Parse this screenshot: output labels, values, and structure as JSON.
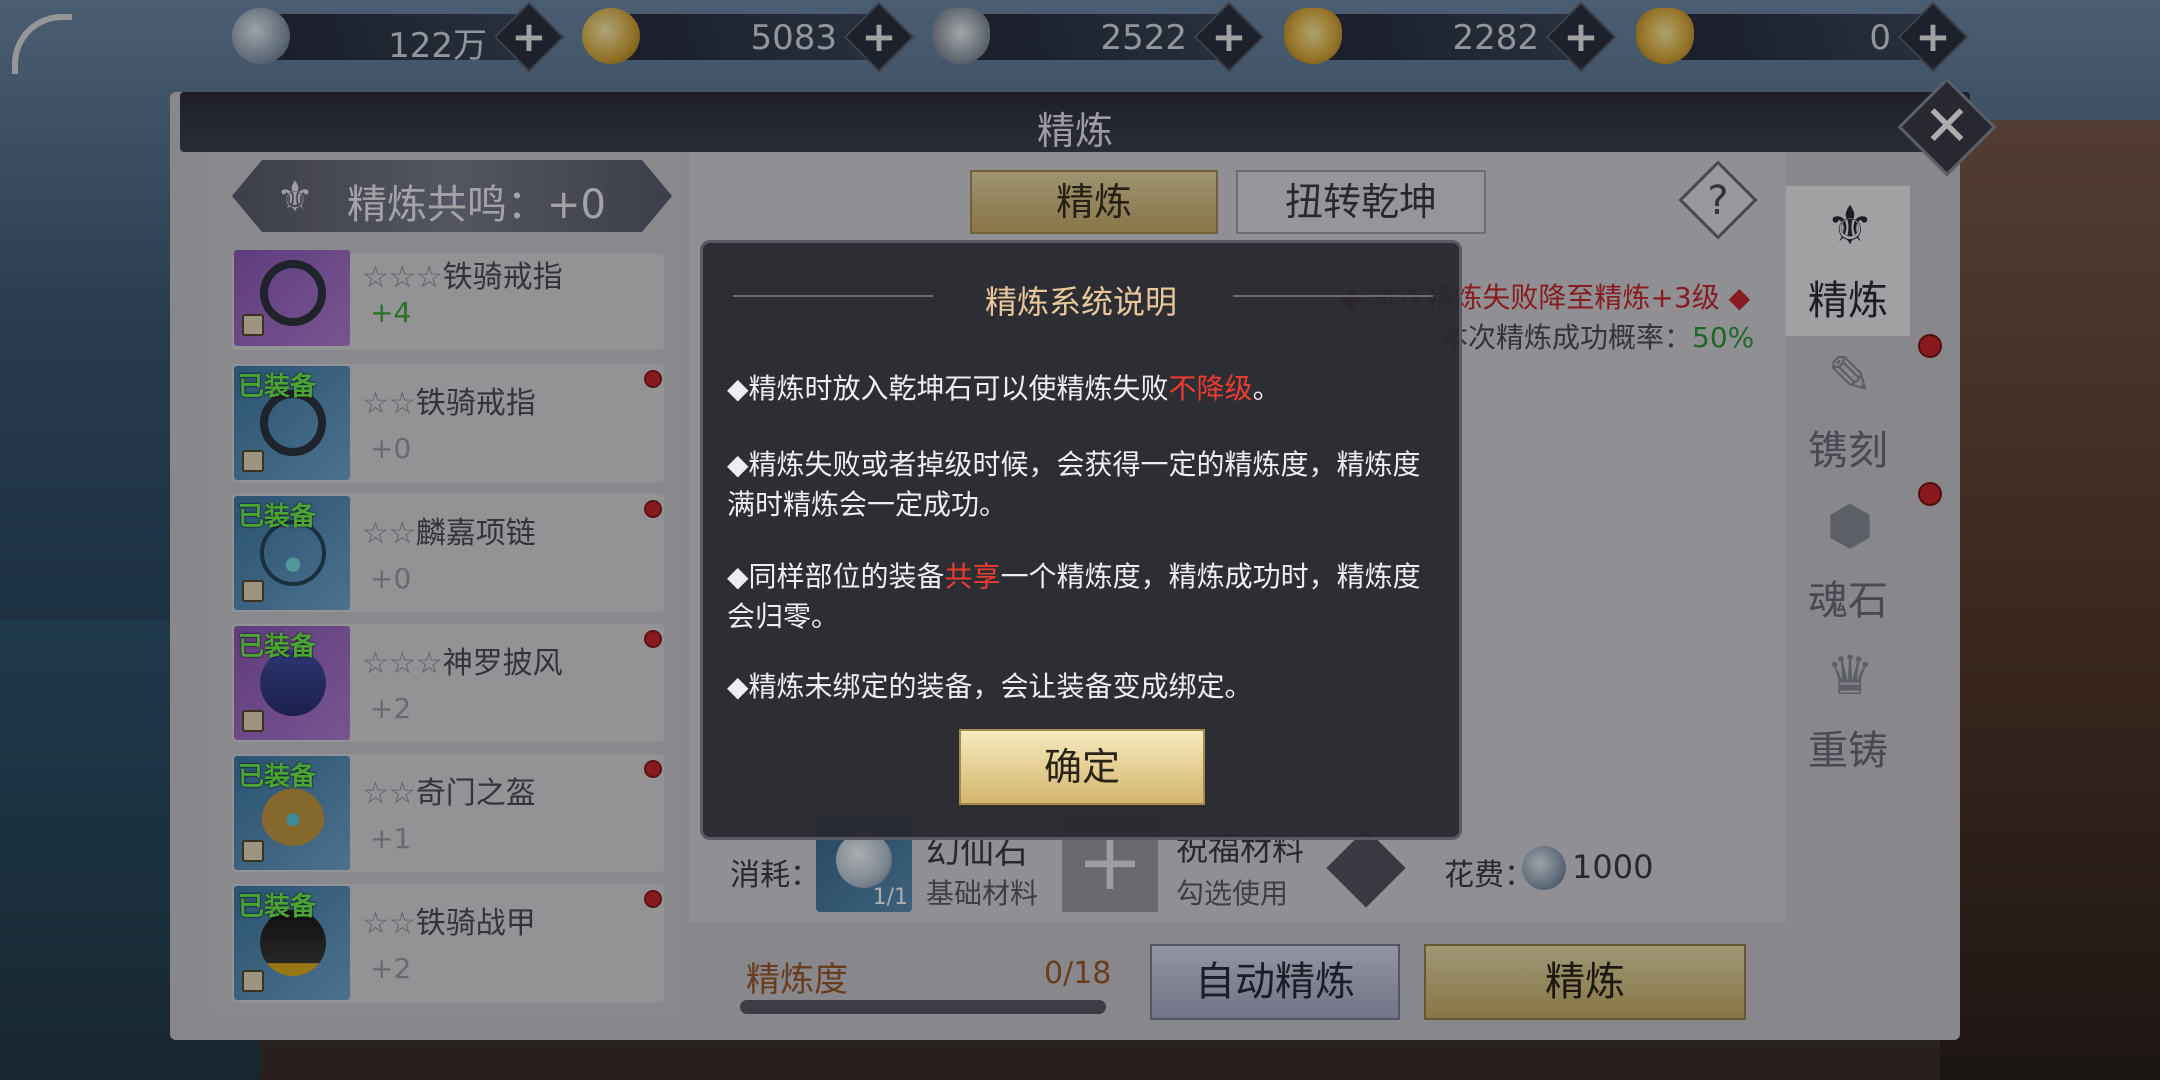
{
  "resources": [
    {
      "icon": "silver-coin-icon",
      "value": "122万"
    },
    {
      "icon": "gold-coin-icon",
      "value": "5083"
    },
    {
      "icon": "silver-ingot-icon",
      "value": "2522"
    },
    {
      "icon": "locked-gold-ingot-icon",
      "value": "2282"
    },
    {
      "icon": "gold-ingot-icon",
      "value": "0"
    }
  ],
  "plus_symbol": "+",
  "window": {
    "title": "精炼",
    "close_symbol": "✕"
  },
  "resonance": {
    "label": "精炼共鸣：+0"
  },
  "equipment": [
    {
      "equipped": "",
      "stars": "☆☆☆",
      "name": "铁骑戒指",
      "level": "+4"
    },
    {
      "equipped": "已装备",
      "stars": "☆☆",
      "name": "铁骑戒指",
      "level": "+0"
    },
    {
      "equipped": "已装备",
      "stars": "☆☆",
      "name": "麟嘉项链",
      "level": "+0"
    },
    {
      "equipped": "已装备",
      "stars": "☆☆☆",
      "name": "神罗披风",
      "level": "+2"
    },
    {
      "equipped": "已装备",
      "stars": "☆☆",
      "name": "奇门之盔",
      "level": "+1"
    },
    {
      "equipped": "已装备",
      "stars": "☆☆",
      "name": "铁骑战甲",
      "level": "+2"
    }
  ],
  "tabs": {
    "refine": "精炼",
    "reverse": "扭转乾坤",
    "help": "?"
  },
  "info": {
    "warning": "◆ 本次精炼失败降至精炼+3级 ◆",
    "rate_label": "本次精炼成功概率：",
    "rate_value": "50%"
  },
  "consume": {
    "label": "消耗：",
    "stone_name": "幻仙石",
    "stone_sub": "基础材料",
    "stone_count": "1/1",
    "add_symbol": "+",
    "bless_name": "祝福材料",
    "bless_sub": "勾选使用",
    "cost_label": "花费：",
    "cost_value": "1000"
  },
  "progress": {
    "label": "精炼度",
    "value": "0/18",
    "fraction": 0
  },
  "buttons": {
    "auto": "自动精炼",
    "refine": "精炼"
  },
  "side_tabs": [
    {
      "icon": "refine-icon",
      "label": "精炼"
    },
    {
      "icon": "engrave-icon",
      "label": "镌刻"
    },
    {
      "icon": "soulstone-icon",
      "label": "魂石"
    },
    {
      "icon": "recast-icon",
      "label": "重铸"
    }
  ],
  "dialog": {
    "title": "精炼系统说明",
    "p1a": "◆精炼时放入乾坤石可以使精炼失败",
    "p1b": "不降级",
    "p1c": "。",
    "p2": "◆精炼失败或者掉级时候，会获得一定的精炼度，精炼度满时精炼会一定成功。",
    "p3a": "◆同样部位的装备",
    "p3b": "共享",
    "p3c": "一个精炼度，精炼成功时，精炼度会归零。",
    "p4": "◆精炼未绑定的装备，会让装备变成绑定。",
    "ok": "确定"
  },
  "colors": {
    "accent_gold": "#c9ae6c",
    "red": "#c8282e",
    "green": "#2f9a3a"
  }
}
